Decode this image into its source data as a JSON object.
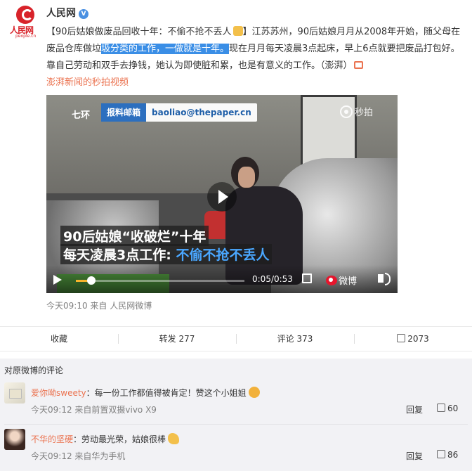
{
  "post": {
    "author": "人民网",
    "verified_badge": "V",
    "logo_text": "人民网",
    "logo_site": "people.cn",
    "content": {
      "part1": "【90后姑娘做废品回收十年：不偷不抢不丢人",
      "part2": "】江苏苏州，90后姑娘月月从2008年开始，随父母在废品仓库做垃",
      "highlight": "圾分类的工作，一做就是十年。",
      "part3": "现在月月每天凌晨3点起床，早上6点就要把废品打包好。靠自己劳动和双手去挣钱，她认为即使脏和累，也是有意义的工作。（澎湃）",
      "source_link": "澎湃新闻的秒拍视频"
    },
    "video": {
      "brand_tag": "七环",
      "mailbox_label": "报料邮箱",
      "mailbox_address": "baoliao@thepaper.cn",
      "watermark": "秒拍",
      "caption_line1": "90后姑娘“收破烂”十年",
      "caption_line2_prefix": "每天凌晨3点工作: ",
      "caption_line2_highlight": "不偷不抢不丢人",
      "time": "0:05/0:53",
      "weibo_logo": "微博",
      "progress": 0.09
    },
    "meta": "今天09:10 来自 人民网微博"
  },
  "actions": {
    "favorite": "收藏",
    "repost": "转发 277",
    "comment": "评论 373",
    "like": "2073"
  },
  "comments": {
    "header": "对原微博的评论",
    "items": [
      {
        "user": "爱你呦sweety",
        "sep": "：",
        "text": "每一份工作都值得被肯定！赞这个小姐姐",
        "time": "今天09:12 来自前置双摄vivo X9",
        "reply": "回复",
        "likes": "60"
      },
      {
        "user": "不华的坚硬",
        "sep": "：",
        "text": "劳动最光荣，姑娘很棒",
        "time": "今天09:12 来自华为手机",
        "reply": "回复",
        "likes": "86"
      }
    ]
  },
  "colors": {
    "accent": "#eb7350",
    "highlight": "#3a8ee6",
    "brand_red": "#d8232a",
    "comment_bg": "#f2f2f5"
  }
}
